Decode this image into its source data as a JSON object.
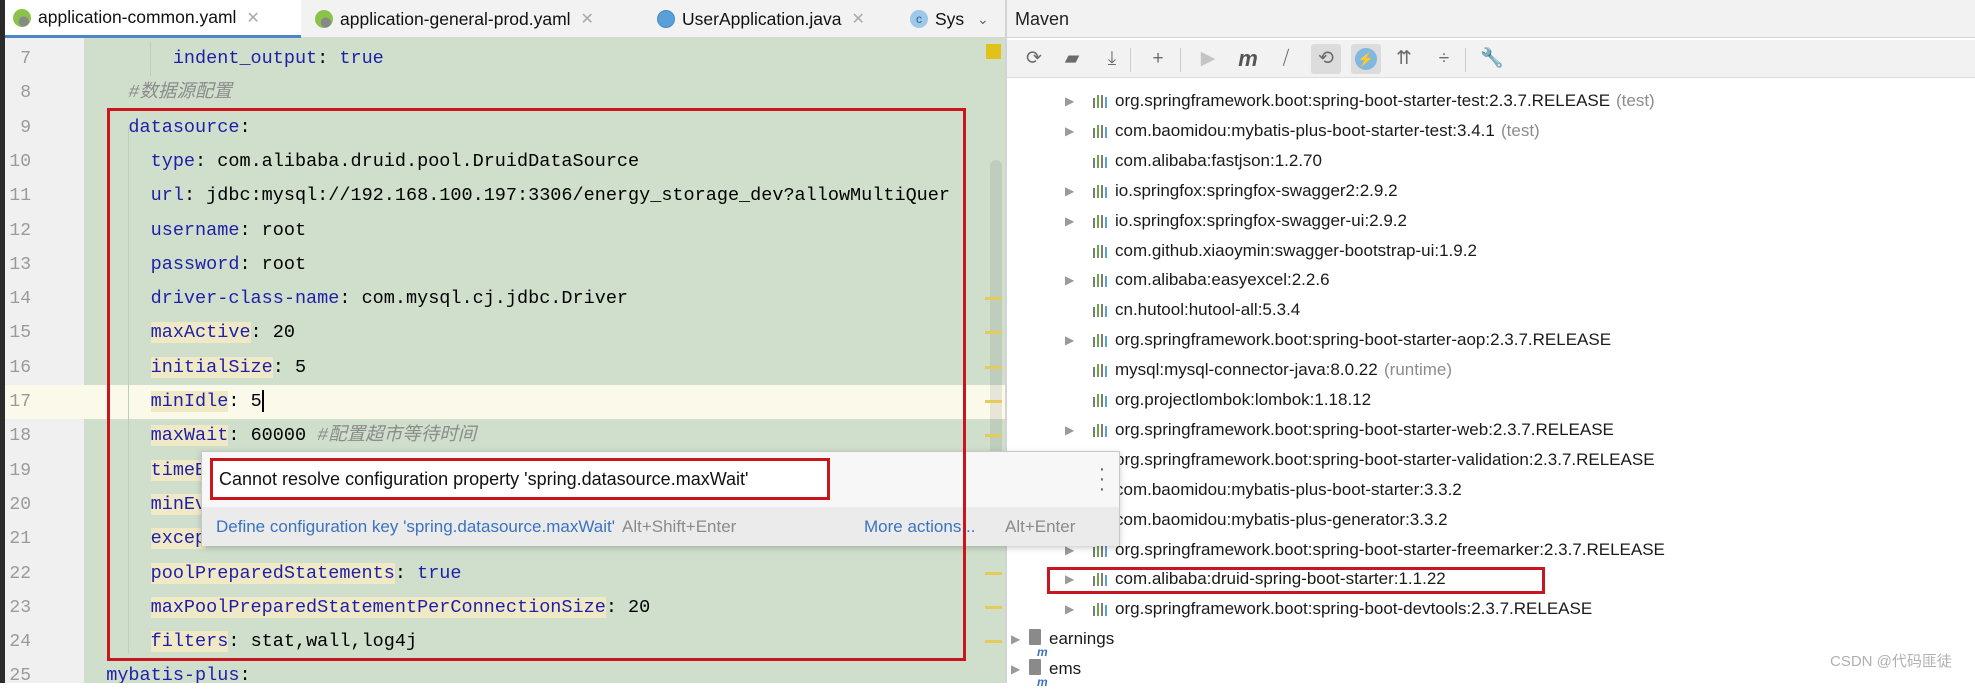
{
  "editor": {
    "tabs": [
      {
        "label": "application-common.yaml",
        "icon": "yaml-spring-icon",
        "active": true
      },
      {
        "label": "application-general-prod.yaml",
        "icon": "yaml-spring-icon",
        "active": false
      },
      {
        "label": "UserApplication.java",
        "icon": "java-spring-icon",
        "active": false
      },
      {
        "label": "Sys",
        "icon": "class-icon",
        "active": false
      }
    ],
    "tab_overflow_icon": "chevron-down-icon",
    "lines": [
      {
        "num": "7",
        "indent": "      ",
        "key": "indent_output",
        "sep": ": ",
        "value": "true",
        "value_is_keyword": true,
        "comment": ""
      },
      {
        "num": "8",
        "indent": "  ",
        "key": "",
        "sep": "",
        "value": "",
        "comment": "#数据源配置"
      },
      {
        "num": "9",
        "indent": "  ",
        "key": "datasource",
        "sep": ":",
        "value": "",
        "comment": ""
      },
      {
        "num": "10",
        "indent": "    ",
        "key": "type",
        "sep": ": ",
        "value": "com.alibaba.druid.pool.DruidDataSource",
        "comment": ""
      },
      {
        "num": "11",
        "indent": "    ",
        "key": "url",
        "sep": ": ",
        "value": "jdbc:mysql://192.168.100.197:3306/energy_storage_dev?allowMultiQuer",
        "comment": ""
      },
      {
        "num": "12",
        "indent": "    ",
        "key": "username",
        "sep": ": ",
        "value": "root",
        "comment": ""
      },
      {
        "num": "13",
        "indent": "    ",
        "key": "password",
        "sep": ": ",
        "value": "root",
        "comment": ""
      },
      {
        "num": "14",
        "indent": "    ",
        "key": "driver-class-name",
        "sep": ": ",
        "value": "com.mysql.cj.jdbc.Driver",
        "comment": ""
      },
      {
        "num": "15",
        "indent": "    ",
        "key": "maxActive",
        "sep": ": ",
        "value": "20",
        "comment": "",
        "unresolved": true
      },
      {
        "num": "16",
        "indent": "    ",
        "key": "initialSize",
        "sep": ": ",
        "value": "5",
        "comment": "",
        "unresolved": true
      },
      {
        "num": "17",
        "indent": "    ",
        "key": "minIdle",
        "sep": ": ",
        "value": "5",
        "comment": "",
        "unresolved": true,
        "current": true
      },
      {
        "num": "18",
        "indent": "    ",
        "key": "maxWait",
        "sep": ": ",
        "value": "60000 ",
        "comment": "#配置超市等待时间",
        "unresolved": true
      },
      {
        "num": "19",
        "indent": "    ",
        "key": "timeB",
        "sep": "",
        "value": "",
        "comment": "",
        "unresolved": true
      },
      {
        "num": "20",
        "indent": "    ",
        "key": "minEv",
        "sep": "",
        "value": "",
        "comment": "",
        "unresolved": true
      },
      {
        "num": "21",
        "indent": "    ",
        "key": "excep",
        "sep": "",
        "value": "",
        "comment": "",
        "unresolved": true
      },
      {
        "num": "22",
        "indent": "    ",
        "key": "poolPreparedStatements",
        "sep": ": ",
        "value": "true",
        "value_is_keyword": true,
        "comment": "",
        "unresolved": true
      },
      {
        "num": "23",
        "indent": "    ",
        "key": "maxPoolPreparedStatementPerConnectionSize",
        "sep": ": ",
        "value": "20",
        "comment": "",
        "unresolved": true
      },
      {
        "num": "24",
        "indent": "    ",
        "key": "filters",
        "sep": ": ",
        "value": "stat,wall,log4j",
        "comment": "",
        "unresolved": true
      },
      {
        "num": "25",
        "indent": "",
        "key": "mybatis-plus",
        "sep": ":",
        "value": "",
        "comment": ""
      }
    ]
  },
  "popup": {
    "message": "Cannot resolve configuration property 'spring.datasource.maxWait'",
    "fix_label": "Define configuration key 'spring.datasource.maxWait'",
    "fix_shortcut": "Alt+Shift+Enter",
    "more_label": "More actions...",
    "more_shortcut": "Alt+Enter",
    "menu_icon": "kebab-menu-icon"
  },
  "maven": {
    "title": "Maven",
    "toolbar": [
      {
        "name": "reload-icon",
        "glyph": "⟳"
      },
      {
        "name": "generate-sources-icon",
        "glyph": "▰"
      },
      {
        "name": "download-icon",
        "glyph": "⤓"
      },
      {
        "name": "add-icon",
        "glyph": "+"
      },
      {
        "name": "run-icon",
        "glyph": "▶"
      },
      {
        "name": "execute-goal-icon",
        "glyph": "m"
      },
      {
        "name": "toggle-offline-icon",
        "glyph": "⧸"
      },
      {
        "name": "skip-tests-icon",
        "glyph": "⟲",
        "pressed": true
      },
      {
        "name": "show-dependencies-icon",
        "glyph": "⚡",
        "pressed": true
      },
      {
        "name": "expand-all-icon",
        "glyph": "⇈"
      },
      {
        "name": "collapse-all-icon",
        "glyph": "÷"
      },
      {
        "name": "settings-wrench-icon",
        "glyph": "🔧"
      }
    ],
    "dependencies": [
      {
        "label": "org.springframework.boot:spring-boot-starter-test:2.3.7.RELEASE",
        "scope": "(test)",
        "expandable": true
      },
      {
        "label": "com.baomidou:mybatis-plus-boot-starter-test:3.4.1",
        "scope": "(test)",
        "expandable": true
      },
      {
        "label": "com.alibaba:fastjson:1.2.70",
        "scope": "",
        "expandable": false
      },
      {
        "label": "io.springfox:springfox-swagger2:2.9.2",
        "scope": "",
        "expandable": true
      },
      {
        "label": "io.springfox:springfox-swagger-ui:2.9.2",
        "scope": "",
        "expandable": true
      },
      {
        "label": "com.github.xiaoymin:swagger-bootstrap-ui:1.9.2",
        "scope": "",
        "expandable": false
      },
      {
        "label": "com.alibaba:easyexcel:2.2.6",
        "scope": "",
        "expandable": true
      },
      {
        "label": "cn.hutool:hutool-all:5.3.4",
        "scope": "",
        "expandable": false
      },
      {
        "label": "org.springframework.boot:spring-boot-starter-aop:2.3.7.RELEASE",
        "scope": "",
        "expandable": true
      },
      {
        "label": "mysql:mysql-connector-java:8.0.22",
        "scope": "(runtime)",
        "expandable": false
      },
      {
        "label": "org.projectlombok:lombok:1.18.12",
        "scope": "",
        "expandable": false
      },
      {
        "label": "org.springframework.boot:spring-boot-starter-web:2.3.7.RELEASE",
        "scope": "",
        "expandable": true
      },
      {
        "label": "org.springframework.boot:spring-boot-starter-validation:2.3.7.RELEASE",
        "scope": "",
        "expandable": true
      },
      {
        "label": "com.baomidou:mybatis-plus-boot-starter:3.3.2",
        "scope": "",
        "expandable": true
      },
      {
        "label": "com.baomidou:mybatis-plus-generator:3.3.2",
        "scope": "",
        "expandable": true
      },
      {
        "label": "org.springframework.boot:spring-boot-starter-freemarker:2.3.7.RELEASE",
        "scope": "",
        "expandable": true
      },
      {
        "label": "com.alibaba:druid-spring-boot-starter:1.1.22",
        "scope": "",
        "expandable": true,
        "highlighted": true
      },
      {
        "label": "org.springframework.boot:spring-boot-devtools:2.3.7.RELEASE",
        "scope": "",
        "expandable": true
      }
    ],
    "modules": [
      {
        "label": "earnings"
      },
      {
        "label": "ems"
      }
    ]
  },
  "watermark": "CSDN @代码匪徒",
  "colors": {
    "editor_bg": "#cfdfcc",
    "annotation_red": "#c9151e",
    "key_blue": "#1f1fa8",
    "unresolved_key_bg": "#f0e9c6",
    "link_blue": "#3b73c2"
  }
}
